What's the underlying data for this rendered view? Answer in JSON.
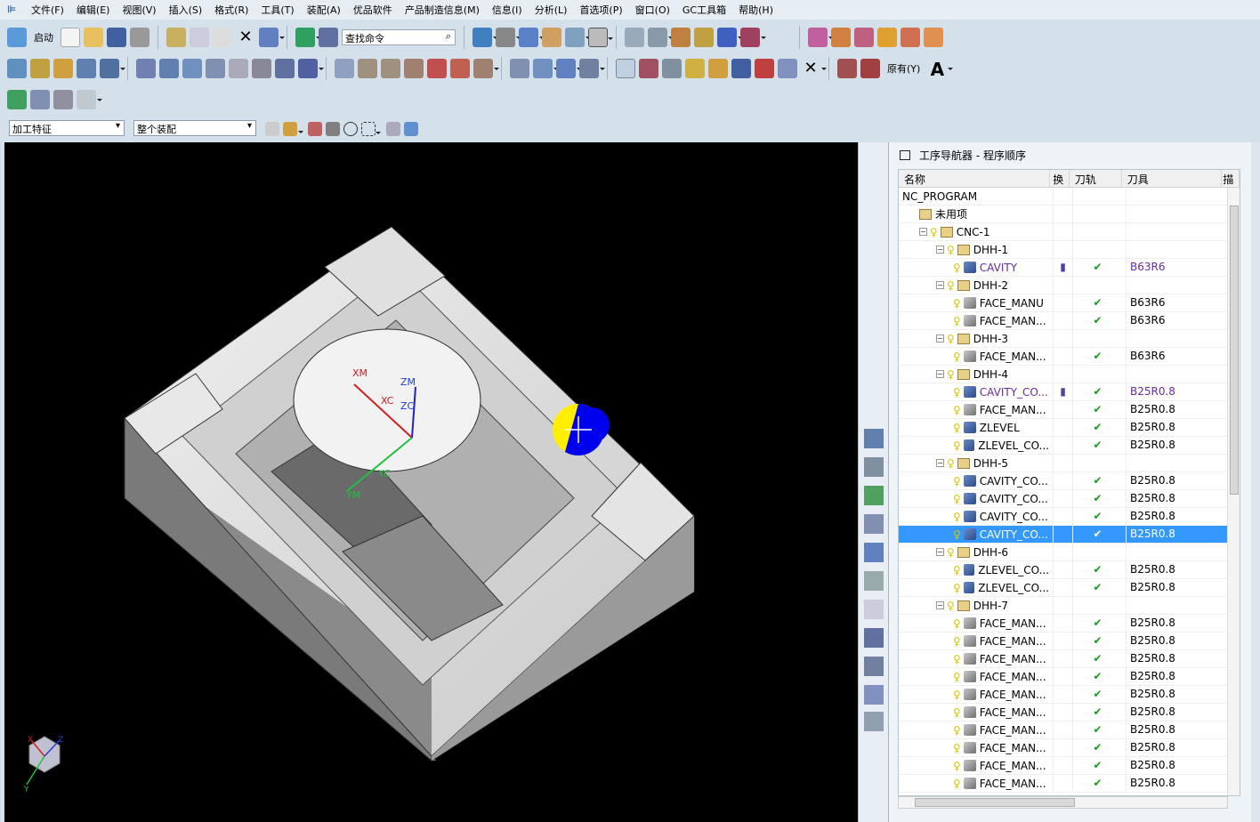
{
  "menu": [
    "文件(F)",
    "编辑(E)",
    "视图(V)",
    "插入(S)",
    "格式(R)",
    "工具(T)",
    "装配(A)",
    "优品软件",
    "产品制造信息(M)",
    "信息(I)",
    "分析(L)",
    "首选项(P)",
    "窗口(O)",
    "GC工具箱",
    "帮助(H)"
  ],
  "toolbar": {
    "start_label": "启动",
    "command_search_placeholder": "查找命令",
    "text_label": "原有(Y)"
  },
  "filters": {
    "type_filter": "加工特征",
    "scope_filter": "整个装配"
  },
  "viewport": {
    "axis_labels": {
      "xm": "XM",
      "xc": "XC",
      "zm": "ZM",
      "zc": "ZC",
      "ym": "YM",
      "yc": "YC"
    },
    "triad": {
      "x": "X",
      "y": "Y",
      "z": "Z"
    }
  },
  "navigator": {
    "title": "工序导航器 - 程序顺序",
    "columns": [
      "名称",
      "换",
      "刀轨",
      "刀具",
      "描述"
    ],
    "rows": [
      {
        "name": "NC_PROGRAM",
        "level": 0,
        "type": "root"
      },
      {
        "name": "未用项",
        "level": 1,
        "type": "group"
      },
      {
        "name": "CNC-1",
        "level": 1,
        "type": "group",
        "expand": true
      },
      {
        "name": "DHH-1",
        "level": 2,
        "type": "group",
        "expand": true
      },
      {
        "name": "CAVITY",
        "level": 3,
        "type": "op",
        "purple": true,
        "tag": true,
        "check": true,
        "tool": "B63R6"
      },
      {
        "name": "DHH-2",
        "level": 2,
        "type": "group",
        "expand": true
      },
      {
        "name": "FACE_MANU",
        "level": 3,
        "type": "face",
        "check": true,
        "tool": "B63R6"
      },
      {
        "name": "FACE_MAN...",
        "level": 3,
        "type": "face",
        "check": true,
        "tool": "B63R6"
      },
      {
        "name": "DHH-3",
        "level": 2,
        "type": "group",
        "expand": true
      },
      {
        "name": "FACE_MAN...",
        "level": 3,
        "type": "face",
        "check": true,
        "tool": "B63R6"
      },
      {
        "name": "DHH-4",
        "level": 2,
        "type": "group",
        "expand": true
      },
      {
        "name": "CAVITY_CO...",
        "level": 3,
        "type": "op",
        "purple": true,
        "tag": true,
        "check": true,
        "tool": "B25R0.8"
      },
      {
        "name": "FACE_MAN...",
        "level": 3,
        "type": "face",
        "check": true,
        "tool": "B25R0.8"
      },
      {
        "name": "ZLEVEL",
        "level": 3,
        "type": "op",
        "check": true,
        "tool": "B25R0.8"
      },
      {
        "name": "ZLEVEL_CO...",
        "level": 3,
        "type": "op",
        "check": true,
        "tool": "B25R0.8"
      },
      {
        "name": "DHH-5",
        "level": 2,
        "type": "group",
        "expand": true
      },
      {
        "name": "CAVITY_CO...",
        "level": 3,
        "type": "op",
        "check": true,
        "tool": "B25R0.8"
      },
      {
        "name": "CAVITY_CO...",
        "level": 3,
        "type": "op",
        "check": true,
        "tool": "B25R0.8"
      },
      {
        "name": "CAVITY_CO...",
        "level": 3,
        "type": "op",
        "check": true,
        "tool": "B25R0.8"
      },
      {
        "name": "CAVITY_CO...",
        "level": 3,
        "type": "op",
        "check": true,
        "tool": "B25R0.8",
        "selected": true
      },
      {
        "name": "DHH-6",
        "level": 2,
        "type": "group",
        "expand": true
      },
      {
        "name": "ZLEVEL_CO...",
        "level": 3,
        "type": "op",
        "check": true,
        "tool": "B25R0.8"
      },
      {
        "name": "ZLEVEL_CO...",
        "level": 3,
        "type": "op",
        "check": true,
        "tool": "B25R0.8"
      },
      {
        "name": "DHH-7",
        "level": 2,
        "type": "group",
        "expand": true
      },
      {
        "name": "FACE_MAN...",
        "level": 3,
        "type": "face",
        "check": true,
        "tool": "B25R0.8"
      },
      {
        "name": "FACE_MAN...",
        "level": 3,
        "type": "face",
        "check": true,
        "tool": "B25R0.8"
      },
      {
        "name": "FACE_MAN...",
        "level": 3,
        "type": "face",
        "check": true,
        "tool": "B25R0.8"
      },
      {
        "name": "FACE_MAN...",
        "level": 3,
        "type": "face",
        "check": true,
        "tool": "B25R0.8"
      },
      {
        "name": "FACE_MAN...",
        "level": 3,
        "type": "face",
        "check": true,
        "tool": "B25R0.8"
      },
      {
        "name": "FACE_MAN...",
        "level": 3,
        "type": "face",
        "check": true,
        "tool": "B25R0.8"
      },
      {
        "name": "FACE_MAN...",
        "level": 3,
        "type": "face",
        "check": true,
        "tool": "B25R0.8"
      },
      {
        "name": "FACE_MAN...",
        "level": 3,
        "type": "face",
        "check": true,
        "tool": "B25R0.8"
      },
      {
        "name": "FACE_MAN...",
        "level": 3,
        "type": "face",
        "check": true,
        "tool": "B25R0.8"
      },
      {
        "name": "FACE_MAN...",
        "level": 3,
        "type": "face",
        "check": true,
        "tool": "B25R0.8"
      }
    ]
  },
  "colors": {
    "selection": "#3399ff",
    "check": "#1a9a1a",
    "purple_op": "#6a2aa8",
    "cursor_ring": "#ffee00",
    "cursor_center": "#0000ee"
  }
}
